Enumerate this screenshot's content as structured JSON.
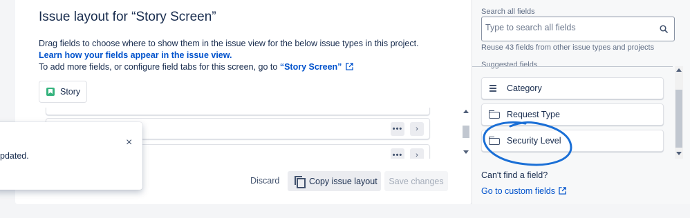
{
  "main": {
    "title": "Issue layout for “Story Screen”",
    "description_line1": "Drag fields to choose where to show them in the issue view for the below issue types in this project.",
    "learn_link": "Learn how your fields appear in the issue view.",
    "description_line3_prefix": "To add more fields, or configure field tabs for this screen, go to",
    "screen_link": "“Story Screen”",
    "issue_type_chip": "Story",
    "row_dots": "•••",
    "row_chevron": "›"
  },
  "toast": {
    "close_symbol": "×",
    "text": "pdated."
  },
  "footer": {
    "discard_label": "Discard",
    "copy_label": "Copy issue layout",
    "save_label": "Save changes"
  },
  "sidebar": {
    "search_label": "Search all fields",
    "search_placeholder": "Type to search all fields",
    "reuse_text": "Reuse 43 fields from other issue types and projects",
    "suggested_label": "Suggested fields",
    "fields": [
      {
        "label": "Category",
        "icon": "lines-icon"
      },
      {
        "label": "Request Type",
        "icon": "select-icon"
      },
      {
        "label": "Security Level",
        "icon": "select-icon"
      }
    ],
    "cant_find": "Can't find a field?",
    "custom_fields_link": "Go to custom fields"
  },
  "colors": {
    "link": "#0052cc",
    "story_green": "#36b37e",
    "annotation_blue": "#1a6fd6"
  }
}
